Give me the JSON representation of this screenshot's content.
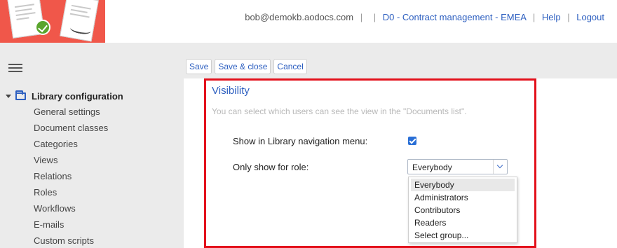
{
  "header": {
    "user_email": "bob@demokb.aodocs.com",
    "separator": "|",
    "library_link": "D0 - Contract management - EMEA",
    "help_link": "Help",
    "logout_link": "Logout"
  },
  "sidebar": {
    "menu_icon": "hamburger-icon",
    "root_label": "Library configuration",
    "items": [
      {
        "label": "General settings"
      },
      {
        "label": "Document classes"
      },
      {
        "label": "Categories"
      },
      {
        "label": "Views"
      },
      {
        "label": "Relations"
      },
      {
        "label": "Roles"
      },
      {
        "label": "Workflows"
      },
      {
        "label": "E-mails"
      },
      {
        "label": "Custom scripts"
      }
    ]
  },
  "toolbar": {
    "save": "Save",
    "save_close": "Save & close",
    "cancel": "Cancel"
  },
  "visibility": {
    "title": "Visibility",
    "description": "You can select which users can see the view in the \"Documents list\".",
    "show_in_nav_label": "Show in Library navigation menu:",
    "show_in_nav_checked": true,
    "role_label": "Only show for role:",
    "role_selected": "Everybody",
    "role_options": [
      {
        "label": "Everybody"
      },
      {
        "label": "Administrators"
      },
      {
        "label": "Contributors"
      },
      {
        "label": "Readers"
      },
      {
        "label": "Select group..."
      }
    ]
  },
  "colors": {
    "brand": "#f0574a",
    "link": "#2d5fc0",
    "highlight": "#e3101b",
    "checkbox": "#2a6fd6"
  }
}
